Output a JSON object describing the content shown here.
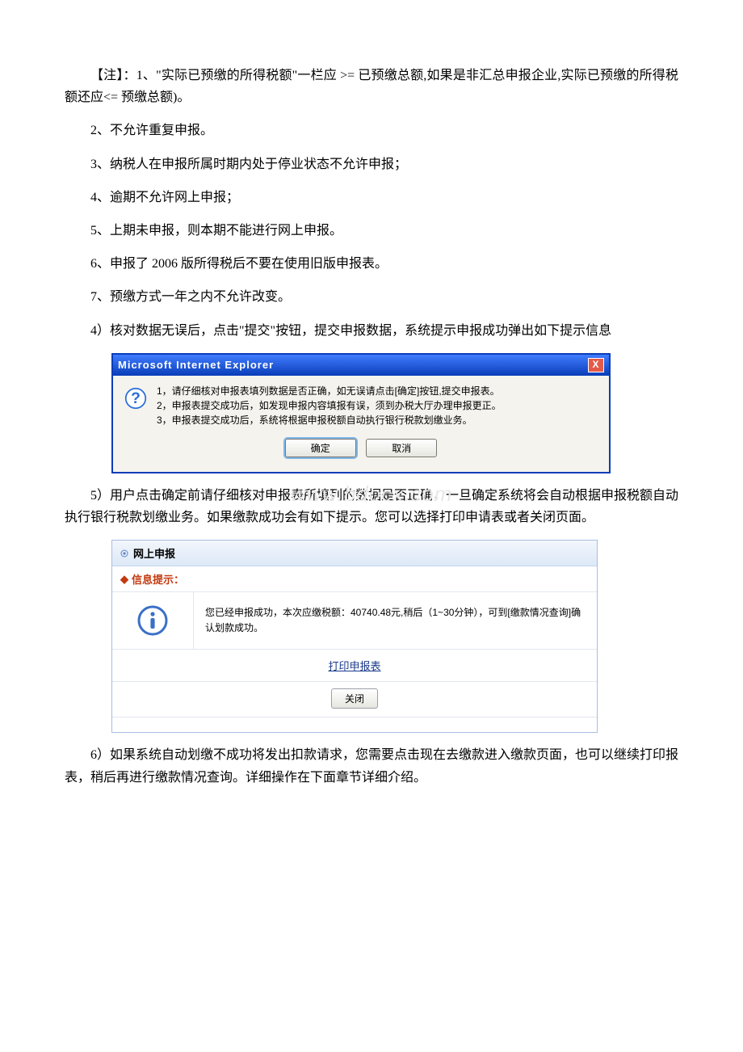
{
  "body": {
    "p1": "【注】：1、\"实际已预缴的所得税额\"一栏应 >= 已预缴总额,如果是非汇总申报企业,实际已预缴的所得税额还应<= 预缴总额)。",
    "p2": "2、不允许重复申报。",
    "p3": "3、纳税人在申报所属时期内处于停业状态不允许申报；",
    "p4": "4、逾期不允许网上申报；",
    "p5": "5、上期未申报，则本期不能进行网上申报。",
    "p6": "6、申报了 2006 版所得税后不要在使用旧版申报表。",
    "p7": "7、预缴方式一年之内不允许改变。",
    "p8": "4）核对数据无误后，点击\"提交\"按钮，提交申报数据，系统提示申报成功弹出如下提示信息",
    "p9": "5）用户点击确定前请仔细核对申报表所填列的数据是否正确，一旦确定系统将会自动根据申报税额自动执行银行税款划缴业务。如果缴款成功会有如下提示。您可以选择打印申请表或者关闭页面。",
    "p10": "6）如果系统自动划缴不成功将发出扣款请求，您需要点击现在去缴款进入缴款页面，也可以继续打印报表，稍后再进行缴款情况查询。详细操作在下面章节详细介绍。"
  },
  "ie_dialog": {
    "title": "Microsoft Internet Explorer",
    "line1": "1，请仔细核对申报表填列数据是否正确，如无误请点击[确定]按钮,提交申报表。",
    "line2": "2，申报表提交成功后，如发现申报内容填报有误，须到办税大厅办理申报更正。",
    "line3": "3，申报表提交成功后，系统将根据申报税额自动执行银行税款划缴业务。",
    "ok": "确定",
    "cancel": "取消",
    "close_x": "X"
  },
  "web_panel": {
    "title": "网上申报",
    "info_label": "信息提示：",
    "message": "您已经申报成功，本次应缴税额：40740.48元,稍后（1~30分钟），可到[缴款情况查询]确认划款成功。",
    "print_link": "打印申报表",
    "close_btn": "关闭"
  },
  "watermark": "www.bdocx.com"
}
